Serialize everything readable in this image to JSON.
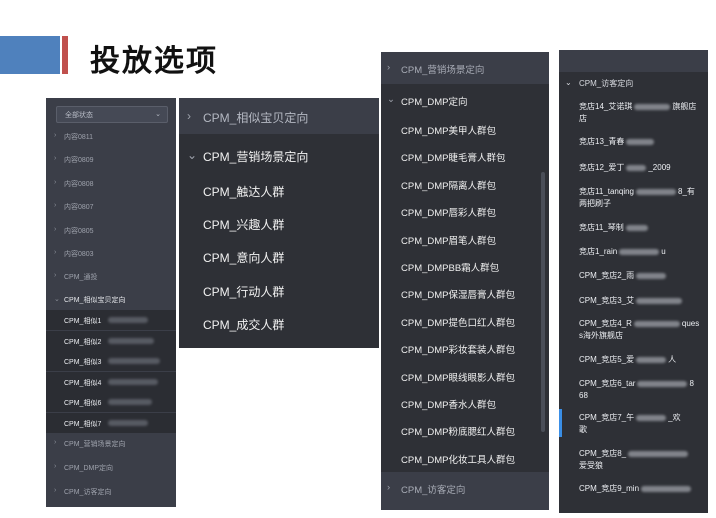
{
  "header": {
    "title": "投放选项"
  },
  "panel1": {
    "select_label": "全部状态",
    "select_arrow": "⌄",
    "items": [
      "内容0811",
      "内容0809",
      "内容0808",
      "内容0807",
      "内容0805",
      "内容0803",
      "CPM_通投"
    ],
    "open_group": "CPM_相似宝贝定向",
    "sub_items": [
      "CPM_相似1",
      "CPM_相似2",
      "CPM_相似3",
      "CPM_相似4",
      "CPM_相似6",
      "CPM_相似7"
    ],
    "after_items": [
      "CPM_营销场景定向",
      "CPM_DMP定向",
      "CPM_访客定向"
    ]
  },
  "panel2": {
    "collapsed": "CPM_相似宝贝定向",
    "open_group": "CPM_营销场景定向",
    "items": [
      "CPM_触达人群",
      "CPM_兴趣人群",
      "CPM_意向人群",
      "CPM_行动人群",
      "CPM_成交人群"
    ]
  },
  "panel3": {
    "collapsed_top": "CPM_营销场景定向",
    "open_group": "CPM_DMP定向",
    "items": [
      "CPM_DMP美甲人群包",
      "CPM_DMP睫毛膏人群包",
      "CPM_DMP隔离人群包",
      "CPM_DMP唇彩人群包",
      "CPM_DMP眉笔人群包",
      "CPM_DMPBB霜人群包",
      "CPM_DMP保湿唇膏人群包",
      "CPM_DMP提色口红人群包",
      "CPM_DMP彩妆套装人群包",
      "CPM_DMP眼线眼影人群包",
      "CPM_DMP香水人群包",
      "CPM_DMP粉底腮红人群包",
      "CPM_DMP化妆工具人群包"
    ],
    "collapsed_bottom": "CPM_访客定向"
  },
  "panel4": {
    "open_group": "CPM_访客定向",
    "items": [
      {
        "line1": "竞店14_艾诺琪",
        "line2": "店",
        "tail": "旗舰店"
      },
      {
        "line1": "竞店13_青春",
        "line2": "",
        "tail": ""
      },
      {
        "line1": "竞店12_爱丁",
        "line2": "",
        "tail": "_2009"
      },
      {
        "line1": "竞店11_tanqing",
        "line2": "两把刷子",
        "tail": "8_有"
      },
      {
        "line1": "竞店11_琴制",
        "line2": "",
        "tail": ""
      },
      {
        "line1": "竞店1_rain",
        "line2": "",
        "tail": "u"
      },
      {
        "line1": "CPM_竞店2_雨",
        "line2": "",
        "tail": ""
      },
      {
        "line1": "CPM_竞店3_艾",
        "line2": "",
        "tail": ""
      },
      {
        "line1": "CPM_竞店4_R",
        "line2": "s海外旗舰店",
        "tail": "ques"
      },
      {
        "line1": "CPM_竞店5_爱",
        "line2": "",
        "tail": "人"
      },
      {
        "line1": "CPM_竞店6_tar",
        "line2": "68",
        "tail": "8"
      },
      {
        "line1": "CPM_竞店7_午",
        "line2": "歌",
        "tail": "_欢"
      },
      {
        "line1": "CPM_竞店8_",
        "line2": "爱受狼",
        "tail": ""
      },
      {
        "line1": "CPM_竞店9_min",
        "line2": "",
        "tail": ""
      }
    ]
  },
  "colors": {
    "accent_blue": "#4f81bd",
    "accent_red": "#c0504d",
    "panel_bg": "#2e3036",
    "header_bg": "#3b3e48",
    "active_marker": "#3a8ee6"
  }
}
